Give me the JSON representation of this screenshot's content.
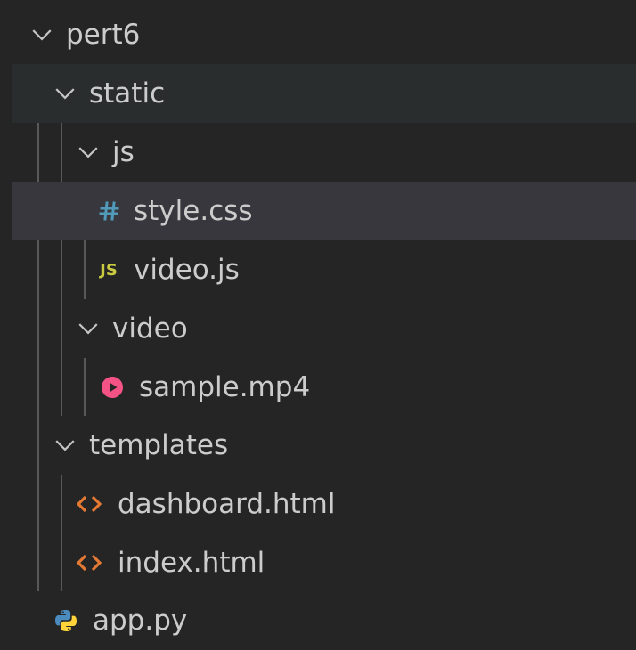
{
  "explorer": {
    "root": {
      "name": "pert6",
      "expanded": true
    },
    "static": {
      "name": "static",
      "expanded": true
    },
    "js": {
      "name": "js",
      "expanded": true
    },
    "style_css": {
      "name": "style.css",
      "icon": "css-hash-icon",
      "icon_color": "#519aba"
    },
    "video_js": {
      "name": "video.js",
      "icon_text": "JS",
      "icon_color": "#cbcb41"
    },
    "video": {
      "name": "video",
      "expanded": true
    },
    "sample_mp4": {
      "name": "sample.mp4",
      "icon": "video-play-icon",
      "icon_color": "#f55385"
    },
    "templates": {
      "name": "templates",
      "expanded": true
    },
    "dashboard_html": {
      "name": "dashboard.html",
      "icon": "html-brackets-icon",
      "icon_color": "#e37933"
    },
    "index_html": {
      "name": "index.html",
      "icon": "html-brackets-icon",
      "icon_color": "#e37933"
    },
    "app_py": {
      "name": "app.py",
      "icon": "python-icon",
      "icon_color": "#4b8bbe"
    }
  }
}
